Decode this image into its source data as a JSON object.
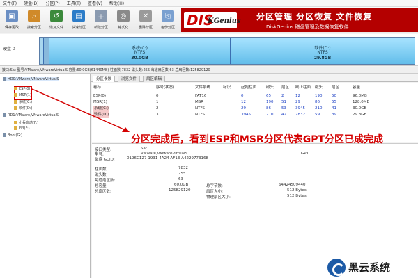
{
  "menu": [
    "文件(F)",
    "硬盘(D)",
    "分区(P)",
    "工具(T)",
    "查看(V)",
    "帮助(H)"
  ],
  "toolbar": [
    {
      "label": "保存更改",
      "icon": "save-icon",
      "color": "#6b8fc4"
    },
    {
      "label": "搜索分区",
      "icon": "search-partition-icon",
      "color": "#d08a2a"
    },
    {
      "label": "恢复文件",
      "icon": "recover-file-icon",
      "color": "#3c8a3c"
    },
    {
      "label": "快速分区",
      "icon": "quick-partition-icon",
      "color": "#2c7cc8"
    },
    {
      "label": "新建分区",
      "icon": "new-partition-icon",
      "color": "#8a9ab0"
    },
    {
      "label": "格式化",
      "icon": "format-icon",
      "color": "#8a8a8a"
    },
    {
      "label": "删除分区",
      "icon": "delete-partition-icon",
      "color": "#9a9a9a"
    },
    {
      "label": "备份分区",
      "icon": "backup-partition-icon",
      "color": "#7aa0d0"
    }
  ],
  "brand": {
    "logo": "DISKGenius",
    "title": "分区管理 分区恢复 文件恢复",
    "subtitle": "DiskGenius 磁盘管理及数据恢复软件"
  },
  "disk": {
    "label1": "硬盘 0",
    "label2": "",
    "partitions": [
      {
        "name": "系统(C:)",
        "fs": "NTFS",
        "size": "30.0GB"
      },
      {
        "name": "软件(D:)",
        "fs": "NTFS",
        "size": "29.8GB"
      }
    ]
  },
  "infobar": "接口:Sat 型号:VMware,VMwareVirtualS 容量:60.0GB(61440MB) 柱面数:7832 磁头数:255 每道扇区数:63 总扇区数:125829120",
  "tree": [
    {
      "label": "HD0:VMware,VMwareVirtualS",
      "level": 0
    },
    {
      "label": "ESP(0)",
      "level": 1
    },
    {
      "label": "MSR(1)",
      "level": 1
    },
    {
      "label": "系统(C:)",
      "level": 1
    },
    {
      "label": "软件(D:)",
      "level": 1
    },
    {
      "label": "RD1:VMware,VMwareVirtualS",
      "level": 0
    },
    {
      "label": "小兵启动(F:)",
      "level": 1
    },
    {
      "label": "EFI(F:)",
      "level": 1
    },
    {
      "label": "Boot(G:)",
      "level": 0
    }
  ],
  "tabs": [
    "分区参数",
    "浏览文件",
    "扇区编辑"
  ],
  "table": {
    "headers": [
      "卷标",
      "序号(状态)",
      "文件系统",
      "标识",
      "起始柱面",
      "磁头",
      "扇区",
      "终止柱面",
      "磁头",
      "扇区",
      "容量"
    ],
    "rows": [
      [
        "ESP(0)",
        "0",
        "FAT16",
        "",
        "0",
        "65",
        "2",
        "12",
        "190",
        "50",
        "96.0MB"
      ],
      [
        "MSR(1)",
        "1",
        "MSR",
        "",
        "12",
        "190",
        "51",
        "29",
        "86",
        "55",
        "128.0MB"
      ],
      [
        "系统(C:)",
        "2",
        "NTFS",
        "",
        "29",
        "86",
        "53",
        "3945",
        "210",
        "41",
        "30.0GB"
      ],
      [
        "软件(D:)",
        "3",
        "NTFS",
        "",
        "3945",
        "210",
        "42",
        "7832",
        "59",
        "39",
        "29.8GB"
      ]
    ]
  },
  "details": {
    "iface_label": "接口类型:",
    "iface_value": "Sat",
    "model_label": "型号:",
    "model_value": "VMware,VMwareVirtualS",
    "guid_label": "磁盘 GUID:",
    "guid_value": "0196C127-1931-4A24-AF1E-A4229773168",
    "cyl_label": "柱面数:",
    "cyl_value": "7832",
    "head_label": "磁头数:",
    "head_value": "255",
    "spt_label": "每道扇区数:",
    "spt_value": "63",
    "cap_label": "总容量:",
    "cap_value": "60.0GB",
    "total_sec_label": "总扇区数:",
    "total_sec_value": "125829120",
    "style_value": "GPT",
    "bytes_label": "总字节数:",
    "bytes_value": "64424509440",
    "sec_size_label": "扇区大小:",
    "sec_size_value": "512 Bytes",
    "phys_label": "物理扇区大小:",
    "phys_value": "512 Bytes"
  },
  "annotation": "分区完成后，看到ESP和MSR分区代表GPT分区已成完成",
  "watermark": "黑云系统",
  "colors": {
    "accent_red": "#d40000",
    "brand_red": "#b40000",
    "bar_blue": "#62bdea"
  }
}
